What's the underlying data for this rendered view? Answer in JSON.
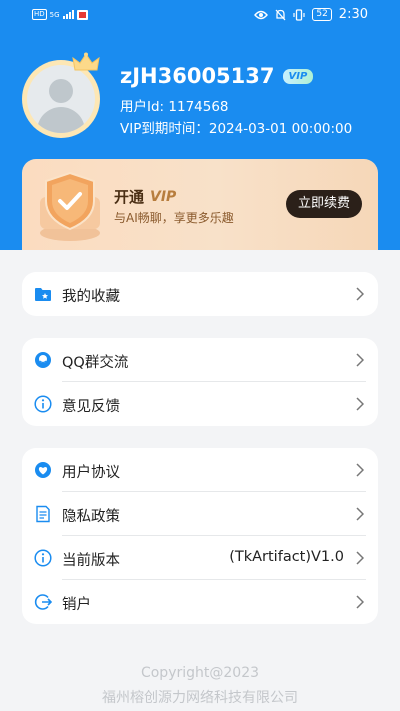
{
  "status_bar": {
    "left_badge": "HD",
    "network": "5G",
    "battery": "52",
    "time": "2:30"
  },
  "profile": {
    "username": "zJH36005137",
    "vip_tag": "VIP",
    "user_id": "用户Id: 1174568",
    "vip_expire": "VIP到期时间：2024-03-01 00:00:00"
  },
  "vip_card": {
    "title": "开通",
    "title_vip": "VIP",
    "desc": "与AI畅聊，享更多乐趣",
    "button": "立即续费"
  },
  "menu_group_1": [
    {
      "label": "我的收藏",
      "icon": "folder-star-icon"
    }
  ],
  "menu_group_2": [
    {
      "label": "QQ群交流",
      "icon": "qq-group-icon"
    },
    {
      "label": "意见反馈",
      "icon": "info-icon"
    }
  ],
  "menu_group_3": [
    {
      "label": "用户协议",
      "icon": "heart-agreement-icon"
    },
    {
      "label": "隐私政策",
      "icon": "document-icon"
    },
    {
      "label": "当前版本",
      "icon": "info-icon",
      "value": "(TkArtifact)V1.0"
    },
    {
      "label": "销户",
      "icon": "logout-icon"
    }
  ],
  "footer": {
    "copyright": "Copyright@2023",
    "company": "福州榕创源力网络科技有限公司"
  },
  "colors": {
    "primary": "#1a8cf0",
    "icon_blue": "#1a8cf0",
    "background": "#f3f4f6"
  }
}
